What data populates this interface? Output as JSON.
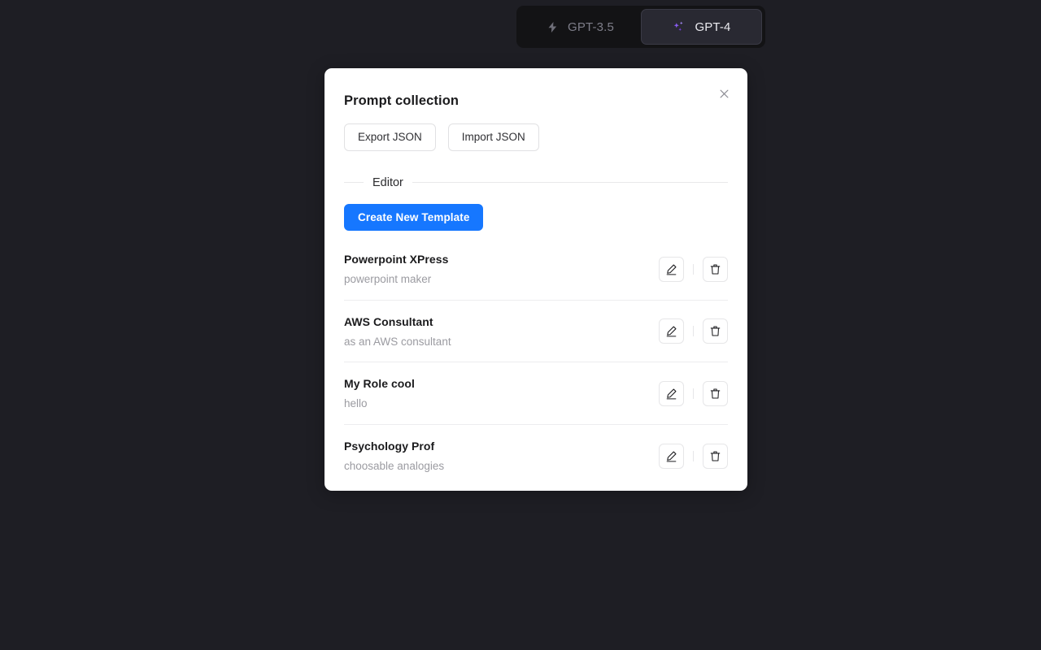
{
  "colors": {
    "page_background": "#1e1e24",
    "switch_background": "#131315",
    "active_tab_background": "#292932",
    "active_tab_text": "#ebebf0",
    "inactive_tab_text": "#7e7e89",
    "sparkle_purple": "#8b5cf6",
    "modal_background": "#ffffff",
    "primary_blue": "#1677ff",
    "title_text": "#1b1b1d",
    "muted_text": "#9b9ba1",
    "divider": "#e8e8ea"
  },
  "model_switch": {
    "tabs": [
      {
        "id": "gpt-3.5",
        "label": "GPT-3.5",
        "icon": "lightning-bolt-icon",
        "active": false
      },
      {
        "id": "gpt-4",
        "label": "GPT-4",
        "icon": "sparkles-icon",
        "active": true
      }
    ]
  },
  "modal": {
    "title": "Prompt collection",
    "close_icon": "close-icon",
    "json_buttons": [
      {
        "id": "export-json",
        "label": "Export JSON"
      },
      {
        "id": "import-json",
        "label": "Import JSON"
      }
    ],
    "editor_section": {
      "label": "Editor",
      "create_button_label": "Create New Template"
    },
    "templates": [
      {
        "name": "Powerpoint XPress",
        "description": "powerpoint maker"
      },
      {
        "name": "AWS Consultant",
        "description": "as an AWS consultant"
      },
      {
        "name": "My Role cool",
        "description": "hello"
      },
      {
        "name": "Psychology Prof",
        "description": "choosable analogies"
      }
    ],
    "row_actions": {
      "edit_icon": "pencil-edit-icon",
      "delete_icon": "trash-delete-icon"
    }
  }
}
